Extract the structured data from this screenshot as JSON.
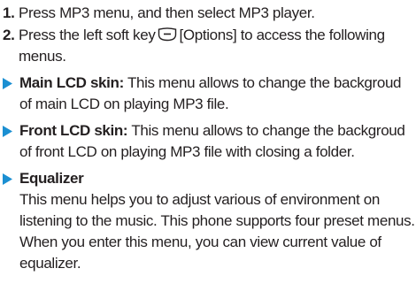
{
  "steps": [
    {
      "number": "1.",
      "text": "Press MP3 menu, and then select MP3 player."
    },
    {
      "number": "2.",
      "text_before": "Press the left soft key",
      "key_icon": "soft-key-icon",
      "text_after": "[Options] to access the following menus."
    }
  ],
  "menus": [
    {
      "term": "Main LCD skin:",
      "description": "This menu allows to change the backgroud of main LCD on playing MP3 file."
    },
    {
      "term": "Front LCD skin:",
      "description": "This menu allows to change the backgroud of front LCD on playing MP3 file with closing a folder."
    },
    {
      "term": "Equalizer",
      "description": "This menu helps you to adjust various of environment on listening to the music. This phone supports four preset menus. When you enter this menu, you can view current value of equalizer."
    }
  ],
  "colors": {
    "arrow": "#1b8fd2",
    "text": "#231f20"
  }
}
